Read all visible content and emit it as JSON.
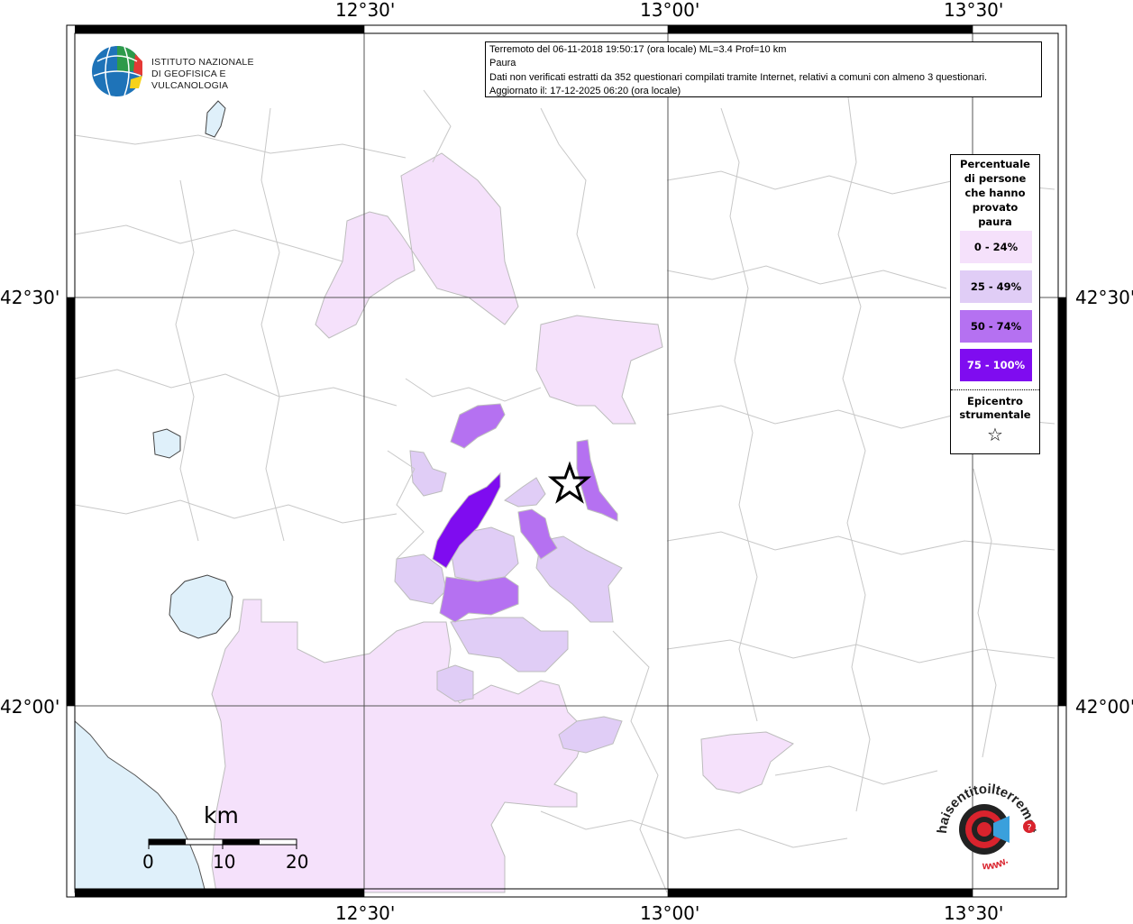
{
  "info": {
    "line1": "Terremoto del 06-11-2018 19:50:17 (ora locale) ML=3.4 Prof=10 km",
    "line2": "Paura",
    "line3": "Dati non verificati estratti da 352 questionari compilati tramite Internet, relativi a comuni con almeno 3 questionari.",
    "line4": "Aggiornato il: 17-12-2025 06:20 (ora locale)"
  },
  "coords": {
    "top": [
      "12°30'",
      "13°00'",
      "13°30'"
    ],
    "bottom": [
      "12°30'",
      "13°00'",
      "13°30'"
    ],
    "left": [
      "42°30'",
      "42°00'"
    ],
    "right": [
      "42°30'",
      "42°00'"
    ]
  },
  "logo": {
    "line1": "ISTITUTO NAZIONALE",
    "line2": "DI GEOFISICA E VULCANOLOGIA",
    "icon": "ingv-globe-icon"
  },
  "legend": {
    "title_lines": [
      "Percentuale",
      "di persone",
      "che hanno",
      "provato",
      "paura"
    ],
    "classes": [
      {
        "label": "0 - 24%",
        "color": "#f5e1fb"
      },
      {
        "label": "25 - 49%",
        "color": "#e0cdf6"
      },
      {
        "label": "50 - 74%",
        "color": "#b571f1"
      },
      {
        "label": "75 - 100%",
        "color": "#7f0cf0"
      }
    ],
    "epicenter_lines": [
      "Epicentro",
      "strumentale"
    ],
    "epicenter_icon": "star-icon"
  },
  "scale": {
    "unit": "km",
    "ticks": [
      "0",
      "10",
      "20"
    ]
  },
  "brand": {
    "text": "haisentitoilterremoto.it",
    "www": "www.",
    "icon": "target-megaphone-icon",
    "colors": {
      "red": "#d9232d",
      "blue": "#3aa0dc"
    }
  },
  "colors": {
    "sea": "#dff0fa",
    "lake": "#dff0fa",
    "boundary": "#bcbcbc"
  }
}
